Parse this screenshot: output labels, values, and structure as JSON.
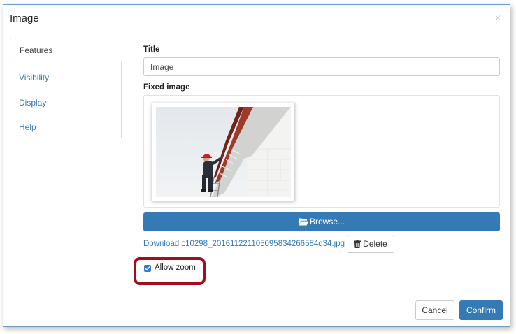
{
  "dialog": {
    "title": "Image",
    "close_glyph": "×"
  },
  "tabs": [
    {
      "label": "Features",
      "active": true
    },
    {
      "label": "Visibility",
      "active": false
    },
    {
      "label": "Display",
      "active": false
    },
    {
      "label": "Help",
      "active": false
    }
  ],
  "form": {
    "title_label": "Title",
    "title_value": "Image",
    "fixed_image_label": "Fixed image",
    "browse_label": "Browse...",
    "download_link": "Download c10298_20161122110509583426​6584d34.jpg",
    "delete_label": "Delete",
    "allow_zoom_label": "Allow zoom",
    "allow_zoom_checked": true
  },
  "footer": {
    "cancel_label": "Cancel",
    "confirm_label": "Confirm"
  },
  "colors": {
    "primary": "#337ab7",
    "highlight": "#a50d1c",
    "checkbox": "#2d7bd6"
  },
  "icons": {
    "browse": "folder-open-icon",
    "delete": "trash-icon",
    "checkbox": "check-icon",
    "close": "close-icon"
  }
}
